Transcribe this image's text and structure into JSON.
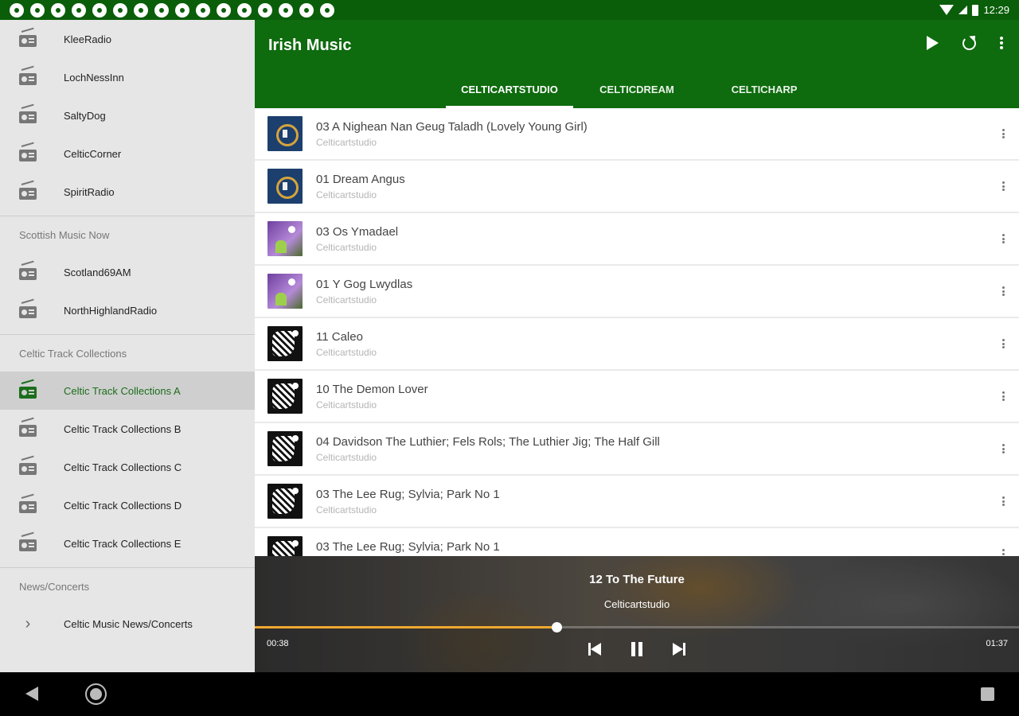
{
  "status_bar": {
    "time": "12:29",
    "notification_icons": [
      "notification-icon",
      "notification-icon",
      "notification-icon",
      "notification-icon",
      "notification-icon",
      "settings-icon",
      "bell-icon",
      "bell-icon",
      "notification-icon",
      "notification-icon",
      "notification-icon",
      "notification-icon",
      "notification-icon",
      "notification-icon",
      "sd-card-icon",
      "circle-icon"
    ]
  },
  "drawer": {
    "top_items": [
      {
        "label": "KleeRadio"
      },
      {
        "label": "LochNessInn"
      },
      {
        "label": "SaltyDog"
      },
      {
        "label": "CelticCorner"
      },
      {
        "label": "SpiritRadio"
      }
    ],
    "sections": [
      {
        "header": "Scottish Music Now",
        "items": [
          {
            "label": "Scotland69AM"
          },
          {
            "label": "NorthHighlandRadio"
          }
        ]
      },
      {
        "header": "Celtic Track Collections",
        "items": [
          {
            "label": "Celtic Track Collections A",
            "selected": true
          },
          {
            "label": "Celtic Track Collections B"
          },
          {
            "label": "Celtic Track Collections C"
          },
          {
            "label": "Celtic Track Collections D"
          },
          {
            "label": "Celtic Track Collections E"
          }
        ]
      },
      {
        "header": "News/Concerts",
        "items": [
          {
            "label": "Celtic Music News/Concerts",
            "icon": "chevron-right-icon"
          }
        ]
      }
    ]
  },
  "appbar": {
    "title": "Irish Music",
    "actions": [
      "play-icon",
      "refresh-icon",
      "more-vert-icon"
    ],
    "tabs": [
      {
        "label": "CELTICARTSTUDIO",
        "active": true
      },
      {
        "label": "CELTICDREAM"
      },
      {
        "label": "CELTICHARP"
      }
    ]
  },
  "tracks": [
    {
      "title": "03 A Nighean Nan Geug Taladh (Lovely Young Girl)",
      "artist": "Celticartstudio",
      "art": "t1"
    },
    {
      "title": "01 Dream Angus",
      "artist": "Celticartstudio",
      "art": "t1"
    },
    {
      "title": "03 Os Ymadael",
      "artist": "Celticartstudio",
      "art": "t2"
    },
    {
      "title": "01 Y Gog Lwydlas",
      "artist": "Celticartstudio",
      "art": "t2"
    },
    {
      "title": "11 Caleo",
      "artist": "Celticartstudio",
      "art": "t3"
    },
    {
      "title": "10 The Demon Lover",
      "artist": "Celticartstudio",
      "art": "t3"
    },
    {
      "title": "04 Davidson The Luthier; Fels Rols; The Luthier Jig; The Half Gill",
      "artist": "Celticartstudio",
      "art": "t3"
    },
    {
      "title": "03 The Lee Rug; Sylvia; Park No 1",
      "artist": "Celticartstudio",
      "art": "t3"
    },
    {
      "title": "03 The Lee Rug; Sylvia; Park No 1",
      "artist": "Celticartstudio",
      "art": "t3"
    }
  ],
  "player": {
    "title": "12 To The Future",
    "artist": "Celticartstudio",
    "elapsed": "00:38",
    "total": "01:37",
    "progress_fraction": 0.395,
    "accent_color": "#f0a830"
  },
  "colors": {
    "primary": "#0e6b0e",
    "status_bar": "#0a5e0a",
    "selected_text": "#1b6e1b"
  }
}
